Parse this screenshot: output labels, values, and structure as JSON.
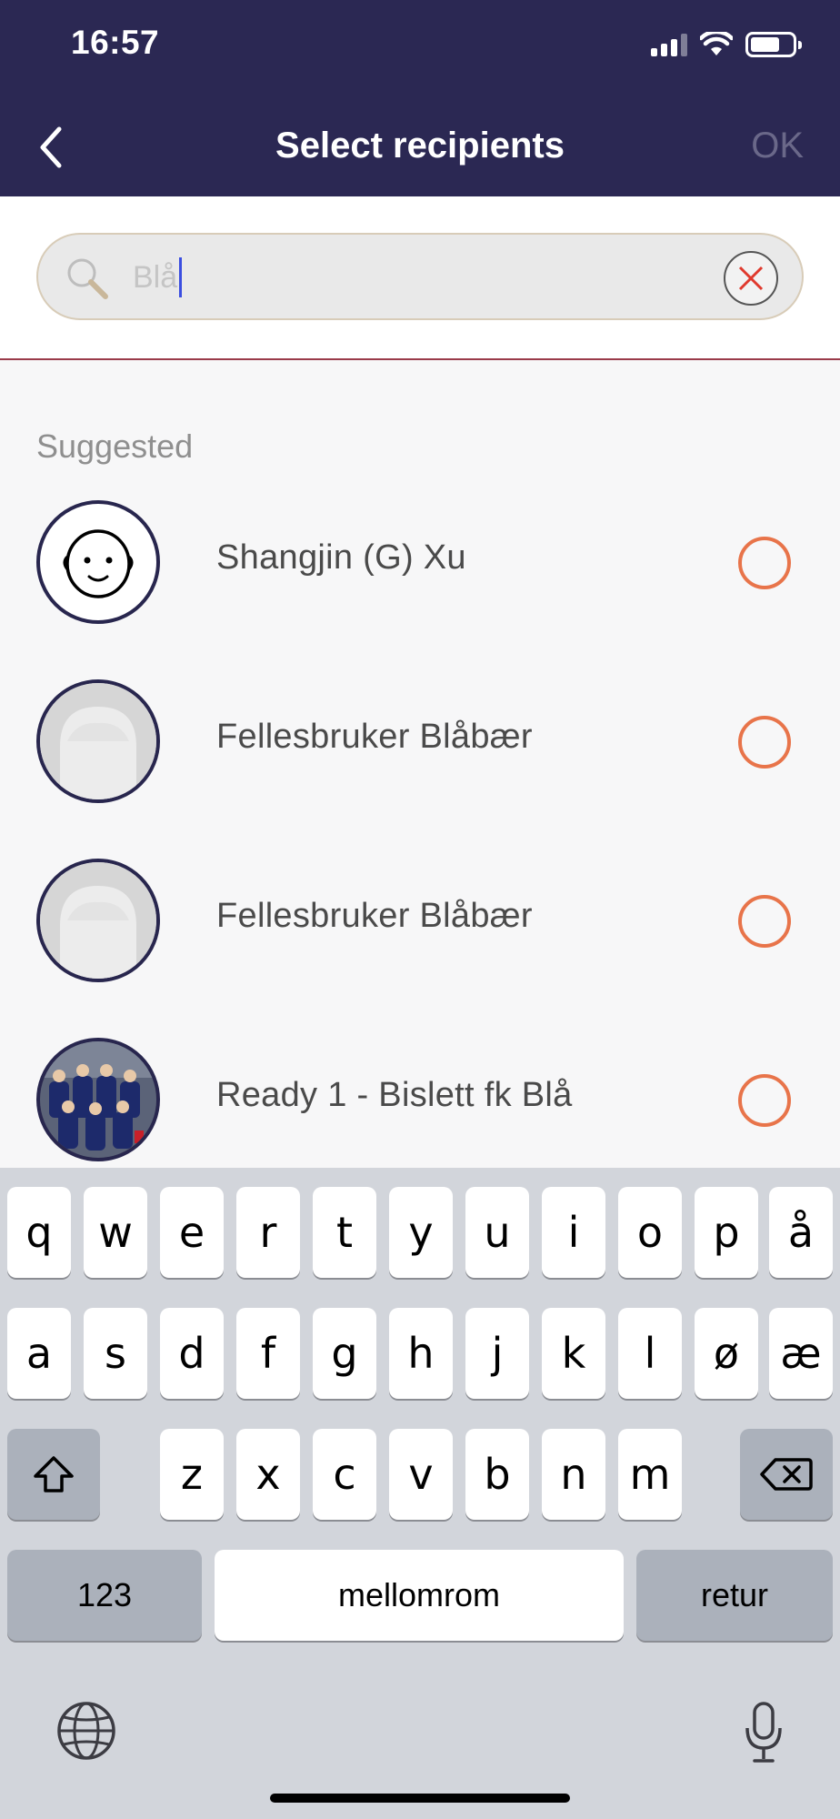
{
  "status_bar": {
    "time": "16:57"
  },
  "nav": {
    "title": "Select recipients",
    "ok_label": "OK"
  },
  "search": {
    "value": "Blå"
  },
  "list": {
    "section_title": "Suggested",
    "items": [
      {
        "name": "Shangjin (G) Xu",
        "avatar": "face-icon",
        "selected": false
      },
      {
        "name": "Fellesbruker Blåbær",
        "avatar": "placeholder-person",
        "selected": false
      },
      {
        "name": "Fellesbruker Blåbær",
        "avatar": "placeholder-person",
        "selected": false
      },
      {
        "name": "Ready 1 - Bislett fk Blå",
        "avatar": "team-photo",
        "selected": false
      }
    ]
  },
  "keyboard": {
    "row1": [
      "q",
      "w",
      "e",
      "r",
      "t",
      "y",
      "u",
      "i",
      "o",
      "p",
      "å"
    ],
    "row2": [
      "a",
      "s",
      "d",
      "f",
      "g",
      "h",
      "j",
      "k",
      "l",
      "ø",
      "æ"
    ],
    "row3": [
      "z",
      "x",
      "c",
      "v",
      "b",
      "n",
      "m"
    ],
    "numbers_label": "123",
    "space_label": "mellomrom",
    "return_label": "retur"
  },
  "colors": {
    "header_bg": "#2b2853",
    "radio": "#e8744a",
    "divider": "#9a3a4a",
    "caret": "#3b4ee0"
  }
}
